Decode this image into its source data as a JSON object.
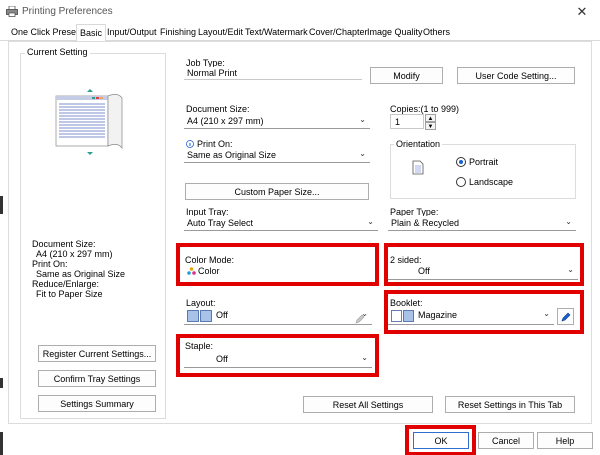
{
  "window": {
    "title": "Printing Preferences",
    "close_glyph": "✕"
  },
  "tabs": [
    {
      "label": "One Click Presets"
    },
    {
      "label": "Basic"
    },
    {
      "label": "Input/Output"
    },
    {
      "label": "Finishing"
    },
    {
      "label": "Layout/Edit"
    },
    {
      "label": "Text/Watermark"
    },
    {
      "label": "Cover/Chapter"
    },
    {
      "label": "Image Quality"
    },
    {
      "label": "Others"
    }
  ],
  "current_setting": {
    "legend": "Current Setting",
    "summary": [
      "Document Size:",
      "A4 (210 x 297 mm)",
      "Print On:",
      "Same as Original Size",
      "Reduce/Enlarge:",
      "Fit to Paper Size"
    ],
    "buttons": {
      "register": "Register Current Settings...",
      "confirm_tray": "Confirm Tray Settings",
      "summary": "Settings Summary"
    }
  },
  "job_type": {
    "label": "Job Type:",
    "value": "Normal Print",
    "modify": "Modify",
    "user_code": "User Code Setting..."
  },
  "document_size": {
    "label": "Document Size:",
    "value": "A4 (210 x 297 mm)"
  },
  "copies": {
    "label": "Copies:(1 to 999)",
    "value": "1"
  },
  "print_on": {
    "label": "Print On:",
    "value": "Same as Original Size"
  },
  "orientation": {
    "legend": "Orientation",
    "portrait": "Portrait",
    "landscape": "Landscape",
    "selected": "Portrait"
  },
  "custom_paper": "Custom Paper Size...",
  "input_tray": {
    "label": "Input Tray:",
    "value": "Auto Tray Select"
  },
  "paper_type": {
    "label": "Paper Type:",
    "value": "Plain & Recycled"
  },
  "color_mode": {
    "label": "Color Mode:",
    "value": "Color"
  },
  "two_sided": {
    "label": "2 sided:",
    "value": "Off"
  },
  "layout": {
    "label": "Layout:",
    "value": "Off"
  },
  "booklet": {
    "label": "Booklet:",
    "value": "Magazine"
  },
  "staple": {
    "label": "Staple:",
    "value": "Off"
  },
  "reset": {
    "all": "Reset All Settings",
    "tab": "Reset Settings in This Tab"
  },
  "footer": {
    "ok": "OK",
    "cancel": "Cancel",
    "help": "Help"
  },
  "colors": {
    "highlight": "#e00000",
    "accent": "#1a5fd0"
  }
}
